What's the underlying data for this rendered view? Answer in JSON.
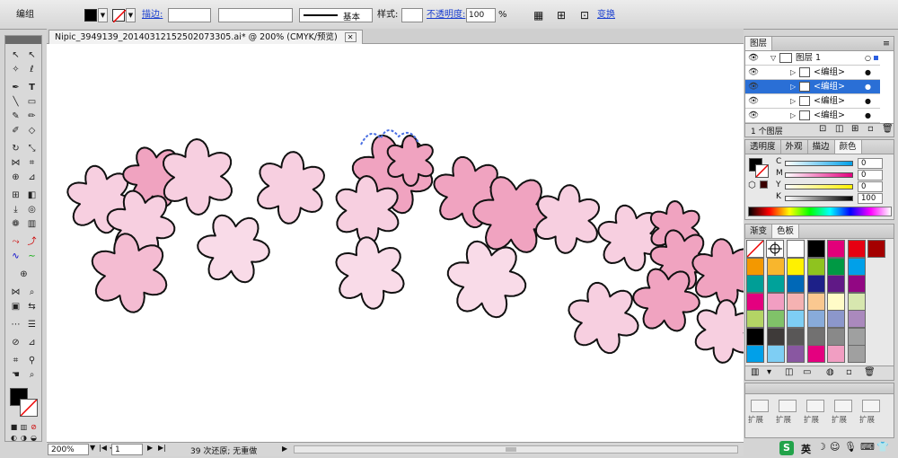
{
  "control_bar": {
    "selection_label": "编组",
    "stroke_label": "描边:",
    "stroke_weight": "",
    "brush_label": "基本",
    "style_label": "样式:",
    "opacity_label": "不透明度:",
    "opacity_value": "100",
    "opacity_unit": "%",
    "transform_label": "变换",
    "fill_color": "#000000"
  },
  "document": {
    "tab_title": "Nipic_3949139_20140312152502073305.ai* @ 200% (CMYK/预览)"
  },
  "status_bar": {
    "zoom": "200%",
    "page": "1",
    "undo_status": "39 次还原; 无重做"
  },
  "layers_panel": {
    "title": "图层",
    "layer_name": "图层 1",
    "items": [
      {
        "label": "<编组>",
        "selected": false
      },
      {
        "label": "<编组>",
        "selected": true
      },
      {
        "label": "<编组>",
        "selected": false
      },
      {
        "label": "<编组>",
        "selected": false
      }
    ],
    "count_label": "1 个图层"
  },
  "color_panel": {
    "tabs": [
      "透明度",
      "外观",
      "描边",
      "颜色"
    ],
    "channels": [
      {
        "name": "C",
        "value": "0"
      },
      {
        "name": "M",
        "value": "0"
      },
      {
        "name": "Y",
        "value": "0"
      },
      {
        "name": "K",
        "value": "100"
      }
    ]
  },
  "swatches_panel": {
    "tabs": [
      "渐变",
      "色板"
    ],
    "rows": [
      [
        "#ffffff",
        "#000000",
        "#e2007a",
        "#e60012",
        "#a40000"
      ],
      [
        "#f39800",
        "#f8b62d",
        "#fff100",
        "#8fc31f",
        "#009944",
        "#00a0e9"
      ],
      [
        "#009e96",
        "#00a29a",
        "#0068b7",
        "#1d2088",
        "#601986",
        "#920783"
      ],
      [
        "#e4007f",
        "#f19ec2",
        "#f5b2b2",
        "#fac890",
        "#fffbc7",
        "#d7e7af"
      ],
      [
        "#b3d465",
        "#80c269",
        "#7ecef4",
        "#88abda",
        "#8c97cb",
        "#aa89bd"
      ],
      [
        "#000000",
        "#3e3a39",
        "#595757",
        "#727171",
        "#898989",
        "#9fa0a0"
      ],
      [
        "#00a0e9",
        "#7ecef4",
        "#8957a1",
        "#e4007f",
        "#f19ec2",
        "#a0a0a0"
      ]
    ]
  },
  "brushes_panel": {
    "labels": [
      "扩展",
      "扩展",
      "扩展",
      "扩展",
      "扩展"
    ]
  },
  "taskbar": {
    "ime_label": "英"
  }
}
